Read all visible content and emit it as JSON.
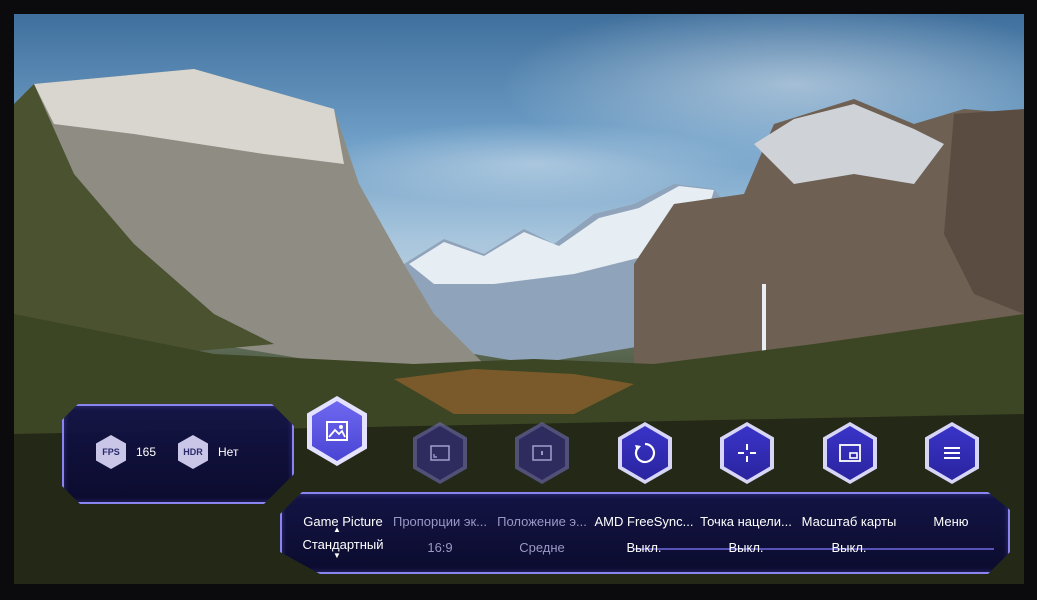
{
  "status": {
    "fps": {
      "icon": "fps-icon",
      "badge": "FPS",
      "value": "165"
    },
    "hdr": {
      "icon": "hdr-icon",
      "badge": "HDR",
      "value": "Нет"
    }
  },
  "menu": {
    "items": [
      {
        "label": "Game Picture",
        "value": "Стандартный",
        "icon": "image-icon",
        "state": "selected"
      },
      {
        "label": "Пропорции эк...",
        "value": "16:9",
        "icon": "aspect-ratio-icon",
        "state": "dim"
      },
      {
        "label": "Положение э...",
        "value": "Средне",
        "icon": "screen-position-icon",
        "state": "dim"
      },
      {
        "label": "AMD FreeSync...",
        "value": "Выкл.",
        "icon": "refresh-sync-icon",
        "state": "normal"
      },
      {
        "label": "Точка нацели...",
        "value": "Выкл.",
        "icon": "crosshair-icon",
        "state": "normal"
      },
      {
        "label": "Масштаб карты",
        "value": "Выкл.",
        "icon": "minimap-icon",
        "state": "normal"
      },
      {
        "label": "Меню",
        "value": "",
        "icon": "menu-icon",
        "state": "normal"
      }
    ]
  },
  "colors": {
    "accent": "#4a44d4",
    "panel": "#12124a",
    "border": "#8a84f0"
  }
}
